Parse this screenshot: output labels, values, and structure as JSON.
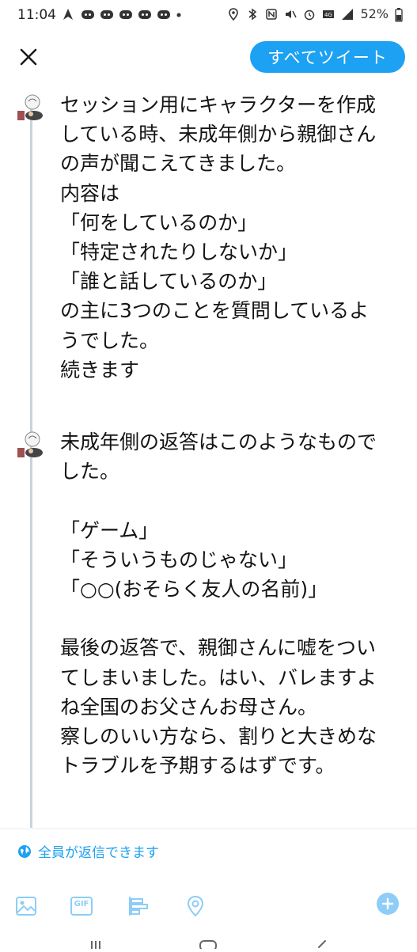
{
  "statusbar": {
    "time": "11:04",
    "battery": "52%",
    "icons": [
      "navigation-icon",
      "discord-icon",
      "discord-icon",
      "discord-icon",
      "discord-icon",
      "discord-icon",
      "location-icon",
      "bluetooth-icon",
      "nfc-icon",
      "mute-icon",
      "alarm-icon",
      "lte-icon",
      "signal-icon",
      "battery-icon"
    ]
  },
  "header": {
    "close_icon": "close-icon",
    "all_tweets_label": "すべてツイート"
  },
  "thread": {
    "tweets": [
      {
        "text": "セッション用にキャラクターを作成\nしている時、未成年側から親御さん\nの声が聞こえてきました。\n内容は\n「何をしているのか」\n「特定されたりしないか」\n「誰と話しているのか」\nの主に3つのことを質問しているよ\nうでした。\n続きます"
      },
      {
        "text": "未成年側の返答はこのようなもので\nした。\n\n「ゲーム」\n「そういうものじゃない」\n「○○(おそらく友人の名前)」\n\n最後の返答で、親御さんに嘘をつい\nてしまいました。はい、バレますよ\nね全国のお父さんお母さん。\n察しのいい方なら、割りと大きめな\nトラブルを予期するはずです。"
      }
    ]
  },
  "reply_setting": {
    "label": "全員が返信できます",
    "icon": "globe-icon"
  },
  "toolbar": {
    "icons": [
      "image-icon",
      "gif-icon",
      "poll-icon",
      "location-icon",
      "add-icon"
    ],
    "gif_label": "GIF"
  },
  "colors": {
    "accent": "#1da1f2",
    "thread_line": "#c8d3dc"
  }
}
